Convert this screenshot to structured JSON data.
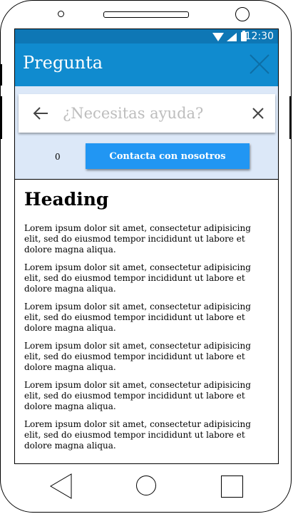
{
  "status_bar": {
    "time": "12:30"
  },
  "app_bar": {
    "title": "Pregunta",
    "close_icon": "close-icon"
  },
  "search": {
    "placeholder": "¿Necesitas ayuda?",
    "value": "",
    "back_icon": "arrow-left-icon",
    "clear_icon": "close-icon"
  },
  "actions": {
    "count_label": "0",
    "contact_label": "Contacta con nosotros"
  },
  "content": {
    "heading": "Heading",
    "paragraphs": [
      "Lorem ipsum dolor sit amet, consectetur adipisicing elit, sed do eiusmod tempor incididunt ut labore et dolore magna aliqua.",
      "Lorem ipsum dolor sit amet, consectetur adipisicing elit, sed do eiusmod tempor incididunt ut labore et dolore magna aliqua.",
      "Lorem ipsum dolor sit amet, consectetur adipisicing elit, sed do eiusmod tempor incididunt ut labore et dolore magna aliqua.",
      "Lorem ipsum dolor sit amet, consectetur adipisicing elit, sed do eiusmod tempor incididunt ut labore et dolore magna aliqua.",
      "Lorem ipsum dolor sit amet, consectetur adipisicing elit, sed do eiusmod tempor incididunt ut labore et dolore magna aliqua.",
      "Lorem ipsum dolor sit amet, consectetur adipisicing elit, sed do eiusmod tempor incididunt ut labore et dolore magna aliqua."
    ]
  },
  "colors": {
    "status_bar": "#0e77b5",
    "app_bar": "#108bcf",
    "search_area": "#dce8f8",
    "button": "#2196f3"
  },
  "nav": {
    "back_icon": "triangle-back-icon",
    "home_icon": "circle-home-icon",
    "recent_icon": "square-recents-icon"
  }
}
